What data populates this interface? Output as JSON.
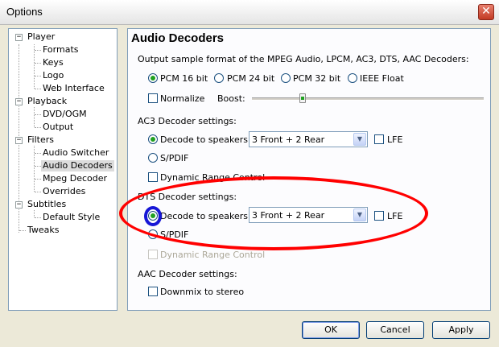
{
  "window": {
    "title": "Options",
    "close_glyph": "✕"
  },
  "tree": {
    "expanded_glyph": "−",
    "items": [
      {
        "label": "Player"
      },
      {
        "label": "Formats"
      },
      {
        "label": "Keys"
      },
      {
        "label": "Logo"
      },
      {
        "label": "Web Interface"
      },
      {
        "label": "Playback"
      },
      {
        "label": "DVD/OGM"
      },
      {
        "label": "Output"
      },
      {
        "label": "Filters"
      },
      {
        "label": "Audio Switcher"
      },
      {
        "label": "Audio Decoders",
        "selected": true
      },
      {
        "label": "Mpeg Decoder"
      },
      {
        "label": "Overrides"
      },
      {
        "label": "Subtitles"
      },
      {
        "label": "Default Style"
      },
      {
        "label": "Tweaks"
      }
    ]
  },
  "panel": {
    "title": "Audio Decoders",
    "output_format": {
      "label": "Output sample format of the MPEG Audio, LPCM, AC3, DTS, AAC Decoders:",
      "options": [
        "PCM 16 bit",
        "PCM 24 bit",
        "PCM 32 bit",
        "IEEE Float"
      ],
      "selected": "PCM 16 bit"
    },
    "normalize": {
      "label": "Normalize",
      "checked": false
    },
    "boost": {
      "label": "Boost:",
      "level_fraction": 0.22
    },
    "ac3": {
      "label": "AC3 Decoder settings:",
      "decode_label": "Decode to speakers:",
      "decode_selected": true,
      "speakers_value": "3 Front + 2 Rear",
      "lfe_label": "LFE",
      "lfe_checked": false,
      "spdif_label": "S/PDIF",
      "drc_label": "Dynamic Range Control",
      "drc_checked": false
    },
    "dts": {
      "label": "DTS Decoder settings:",
      "decode_label": "Decode to speakers:",
      "decode_selected": true,
      "speakers_value": "3 Front + 2 Rear",
      "lfe_label": "LFE",
      "lfe_checked": false,
      "spdif_label": "S/PDIF",
      "drc_label": "Dynamic Range Control",
      "drc_disabled": true
    },
    "aac": {
      "label": "AAC Decoder settings:",
      "downmix_label": "Downmix to stereo",
      "downmix_checked": false
    }
  },
  "buttons": {
    "ok": "OK",
    "cancel": "Cancel",
    "apply": "Apply"
  },
  "colors": {
    "annotation_red": "#ff0000",
    "annotation_blue": "#1616d6",
    "radio_dot": "#21a121"
  }
}
